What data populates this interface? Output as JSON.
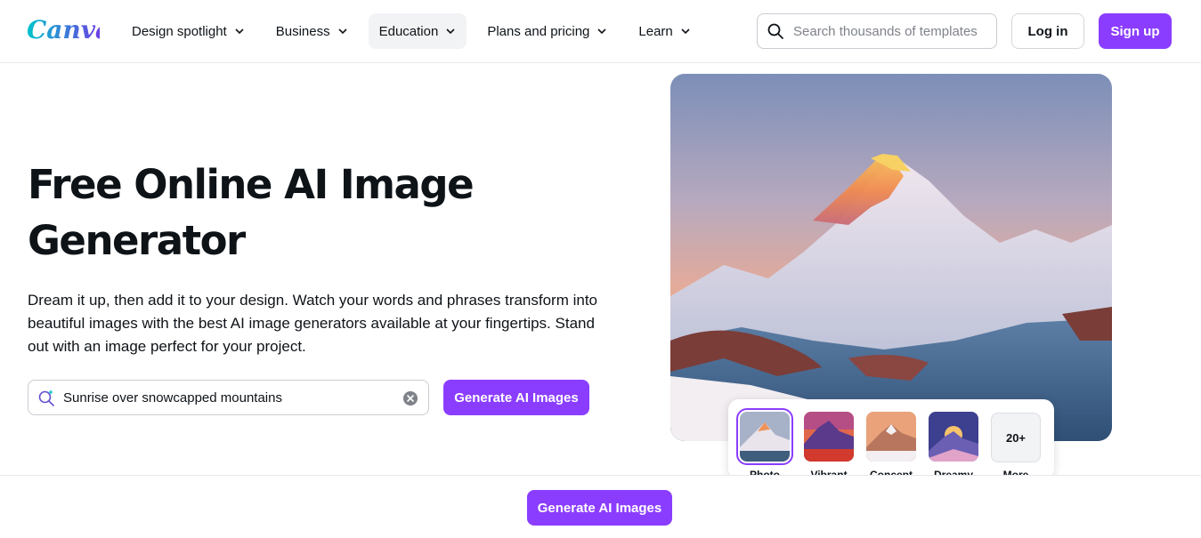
{
  "header": {
    "logo_text": "Canva",
    "nav": [
      {
        "label": "Design spotlight"
      },
      {
        "label": "Business"
      },
      {
        "label": "Education"
      },
      {
        "label": "Plans and pricing"
      },
      {
        "label": "Learn"
      }
    ],
    "active_nav": "Education",
    "search": {
      "placeholder": "Search thousands of templates",
      "icon": "search-icon"
    },
    "login_label": "Log in",
    "signup_label": "Sign up"
  },
  "hero": {
    "title": "Free Online AI Image Generator",
    "description": "Dream it up, then add it to your design. Watch your words and phrases transform into beautiful images with the best AI image generators available at your fingertips. Stand out with an image perfect for your project.",
    "prompt": {
      "value": "Sunrise over snowcapped mountains",
      "icon": "sparkle-search-icon",
      "clear_icon": "clear-icon"
    },
    "generate_label": "Generate AI Images"
  },
  "styles": {
    "items": [
      {
        "label": "Photo",
        "selected": true
      },
      {
        "label": "Vibrant",
        "selected": false
      },
      {
        "label": "Concept",
        "selected": false
      },
      {
        "label": "Dreamy",
        "selected": false
      }
    ],
    "more": {
      "count": "20+",
      "label": "More"
    }
  },
  "bottom_bar": {
    "generate_label": "Generate AI Images"
  },
  "colors": {
    "brand": "#8b3dff",
    "text": "#0e1318",
    "logo_gradient": [
      "#00c4cc",
      "#7d2ae8"
    ]
  }
}
